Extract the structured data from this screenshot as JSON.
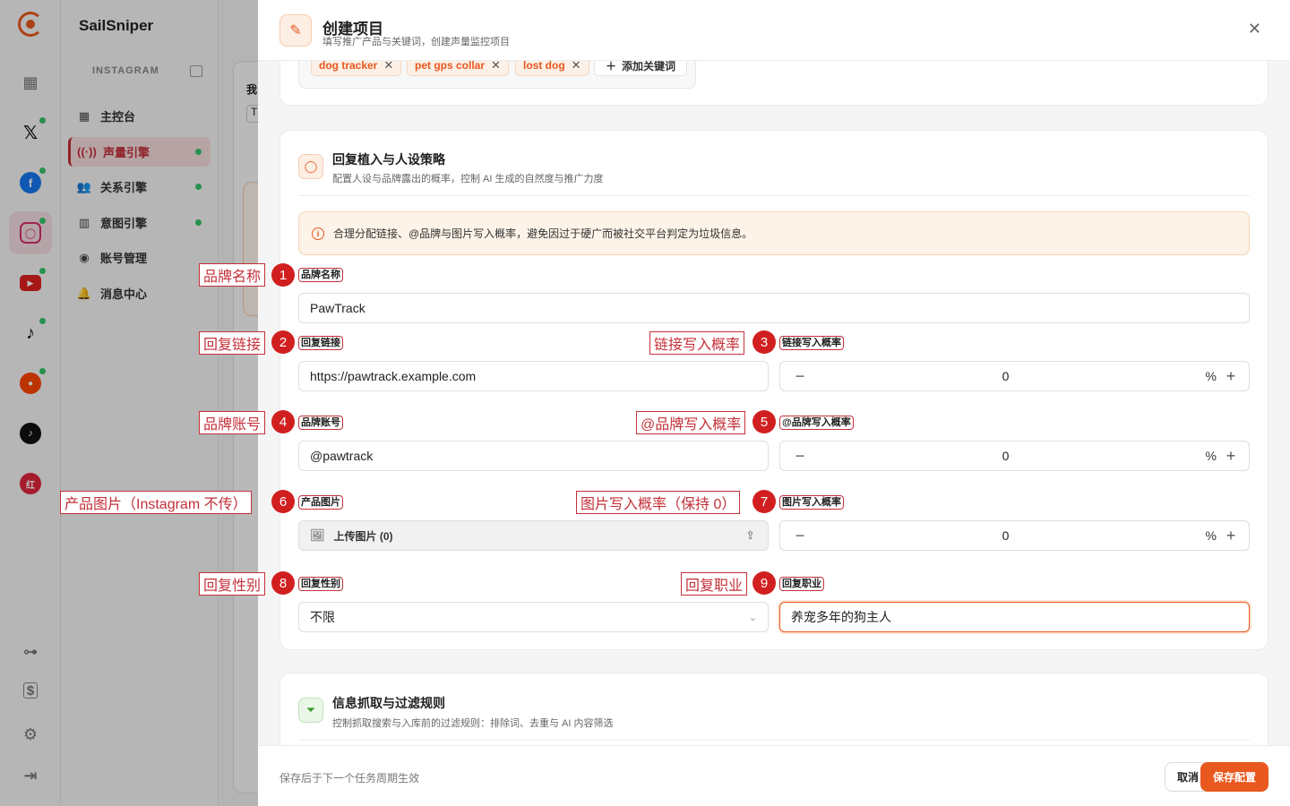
{
  "app": {
    "name": "SailSniper"
  },
  "sidebar": {
    "section_title": "INSTAGRAM",
    "items": [
      {
        "label": "主控台",
        "icon": "dashboard-icon"
      },
      {
        "label": "声量引擎",
        "icon": "broadcast-icon",
        "active": true
      },
      {
        "label": "关系引擎",
        "icon": "users-icon"
      },
      {
        "label": "意图引擎",
        "icon": "bar-chart-icon"
      },
      {
        "label": "账号管理",
        "icon": "user-circle-icon"
      },
      {
        "label": "消息中心",
        "icon": "bell-icon"
      }
    ]
  },
  "background": {
    "peek_text_1": "我",
    "peek_text_2": "T"
  },
  "panel": {
    "title": "创建项目",
    "subtitle": "填写推广产品与关键词，创建声量监控项目",
    "keywords": [
      "dog tracker",
      "pet gps collar",
      "lost dog"
    ],
    "add_keyword": "添加关键词",
    "footer_note": "保存后于下一个任务周期生效",
    "cancel": "取消",
    "save": "保存配置"
  },
  "strategy": {
    "title": "回复植入与人设策略",
    "subtitle": "配置人设与品牌露出的概率，控制 AI 生成的自然度与推广力度",
    "notice": "合理分配链接、@品牌与图片写入概率，避免因过于硬广而被社交平台判定为垃圾信息。",
    "brand_name_label": "品牌名称",
    "brand_name_value": "PawTrack",
    "reply_link_label": "回复链接",
    "reply_link_value": "https://pawtrack.example.com",
    "link_prob_label": "链接写入概率",
    "link_prob_value": "0",
    "brand_account_label": "品牌账号",
    "brand_account_value": "@pawtrack",
    "mention_prob_label": "@品牌写入概率",
    "mention_prob_value": "0",
    "product_image_label": "产品图片",
    "upload_button": "上传图片 (0)",
    "image_prob_label": "图片写入概率",
    "image_prob_value": "0",
    "gender_label": "回复性别",
    "gender_value": "不限",
    "occupation_label": "回复职业",
    "occupation_value": "养宠多年的狗主人",
    "percent": "%"
  },
  "filter": {
    "title": "信息抓取与过滤规则",
    "subtitle": "控制抓取搜索与入库前的过滤规则：排除词、去重与 AI 内容筛选"
  },
  "annotations": [
    {
      "n": "1",
      "text": "品牌名称"
    },
    {
      "n": "2",
      "text": "回复链接"
    },
    {
      "n": "3",
      "text": "链接写入概率"
    },
    {
      "n": "4",
      "text": "品牌账号"
    },
    {
      "n": "5",
      "text": "@品牌写入概率"
    },
    {
      "n": "6",
      "text": "产品图片（Instagram 不传）"
    },
    {
      "n": "7",
      "text": "图片写入概率（保持 0）"
    },
    {
      "n": "8",
      "text": "回复性别"
    },
    {
      "n": "9",
      "text": "回复职业"
    }
  ],
  "colors": {
    "accent": "#e8581f",
    "active_nav": "#c4303a",
    "annotation": "#d11f1f",
    "online_dot": "#35c46a"
  }
}
